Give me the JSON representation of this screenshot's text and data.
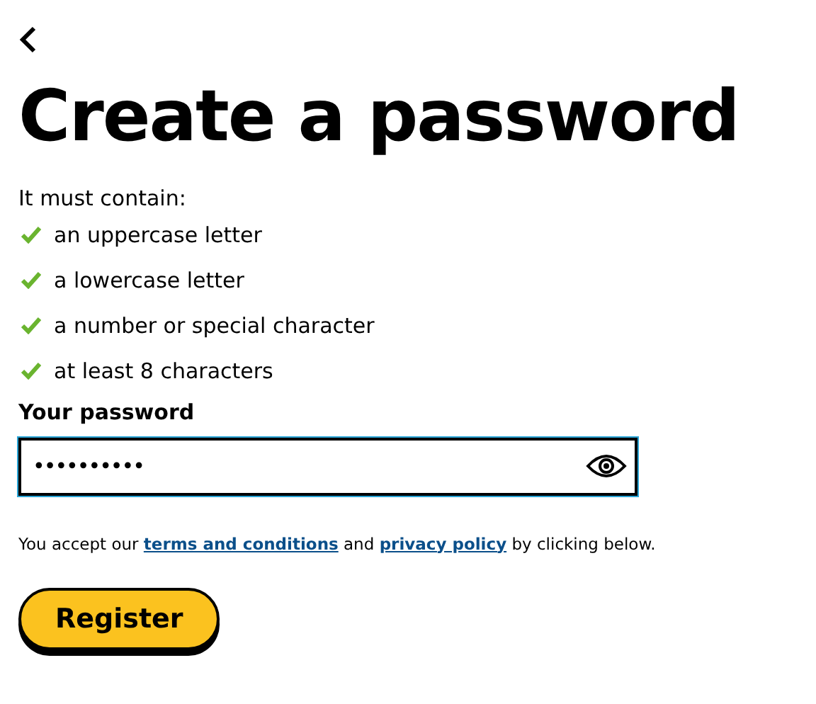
{
  "title": "Create a password",
  "intro": "It must contain:",
  "requirements": [
    {
      "text": "an uppercase letter",
      "met": true
    },
    {
      "text": "a lowercase letter",
      "met": true
    },
    {
      "text": "a number or special character",
      "met": true
    },
    {
      "text": "at least 8 characters",
      "met": true
    }
  ],
  "password": {
    "label": "Your password",
    "value": "••••••••••",
    "focused": true
  },
  "consent": [
    {
      "kind": "text",
      "text": "You accept our "
    },
    {
      "kind": "link",
      "text": "terms and conditions"
    },
    {
      "kind": "text",
      "text": " and "
    },
    {
      "kind": "link",
      "text": "privacy policy"
    },
    {
      "kind": "text",
      "text": " by clicking below."
    }
  ],
  "button": "Register"
}
